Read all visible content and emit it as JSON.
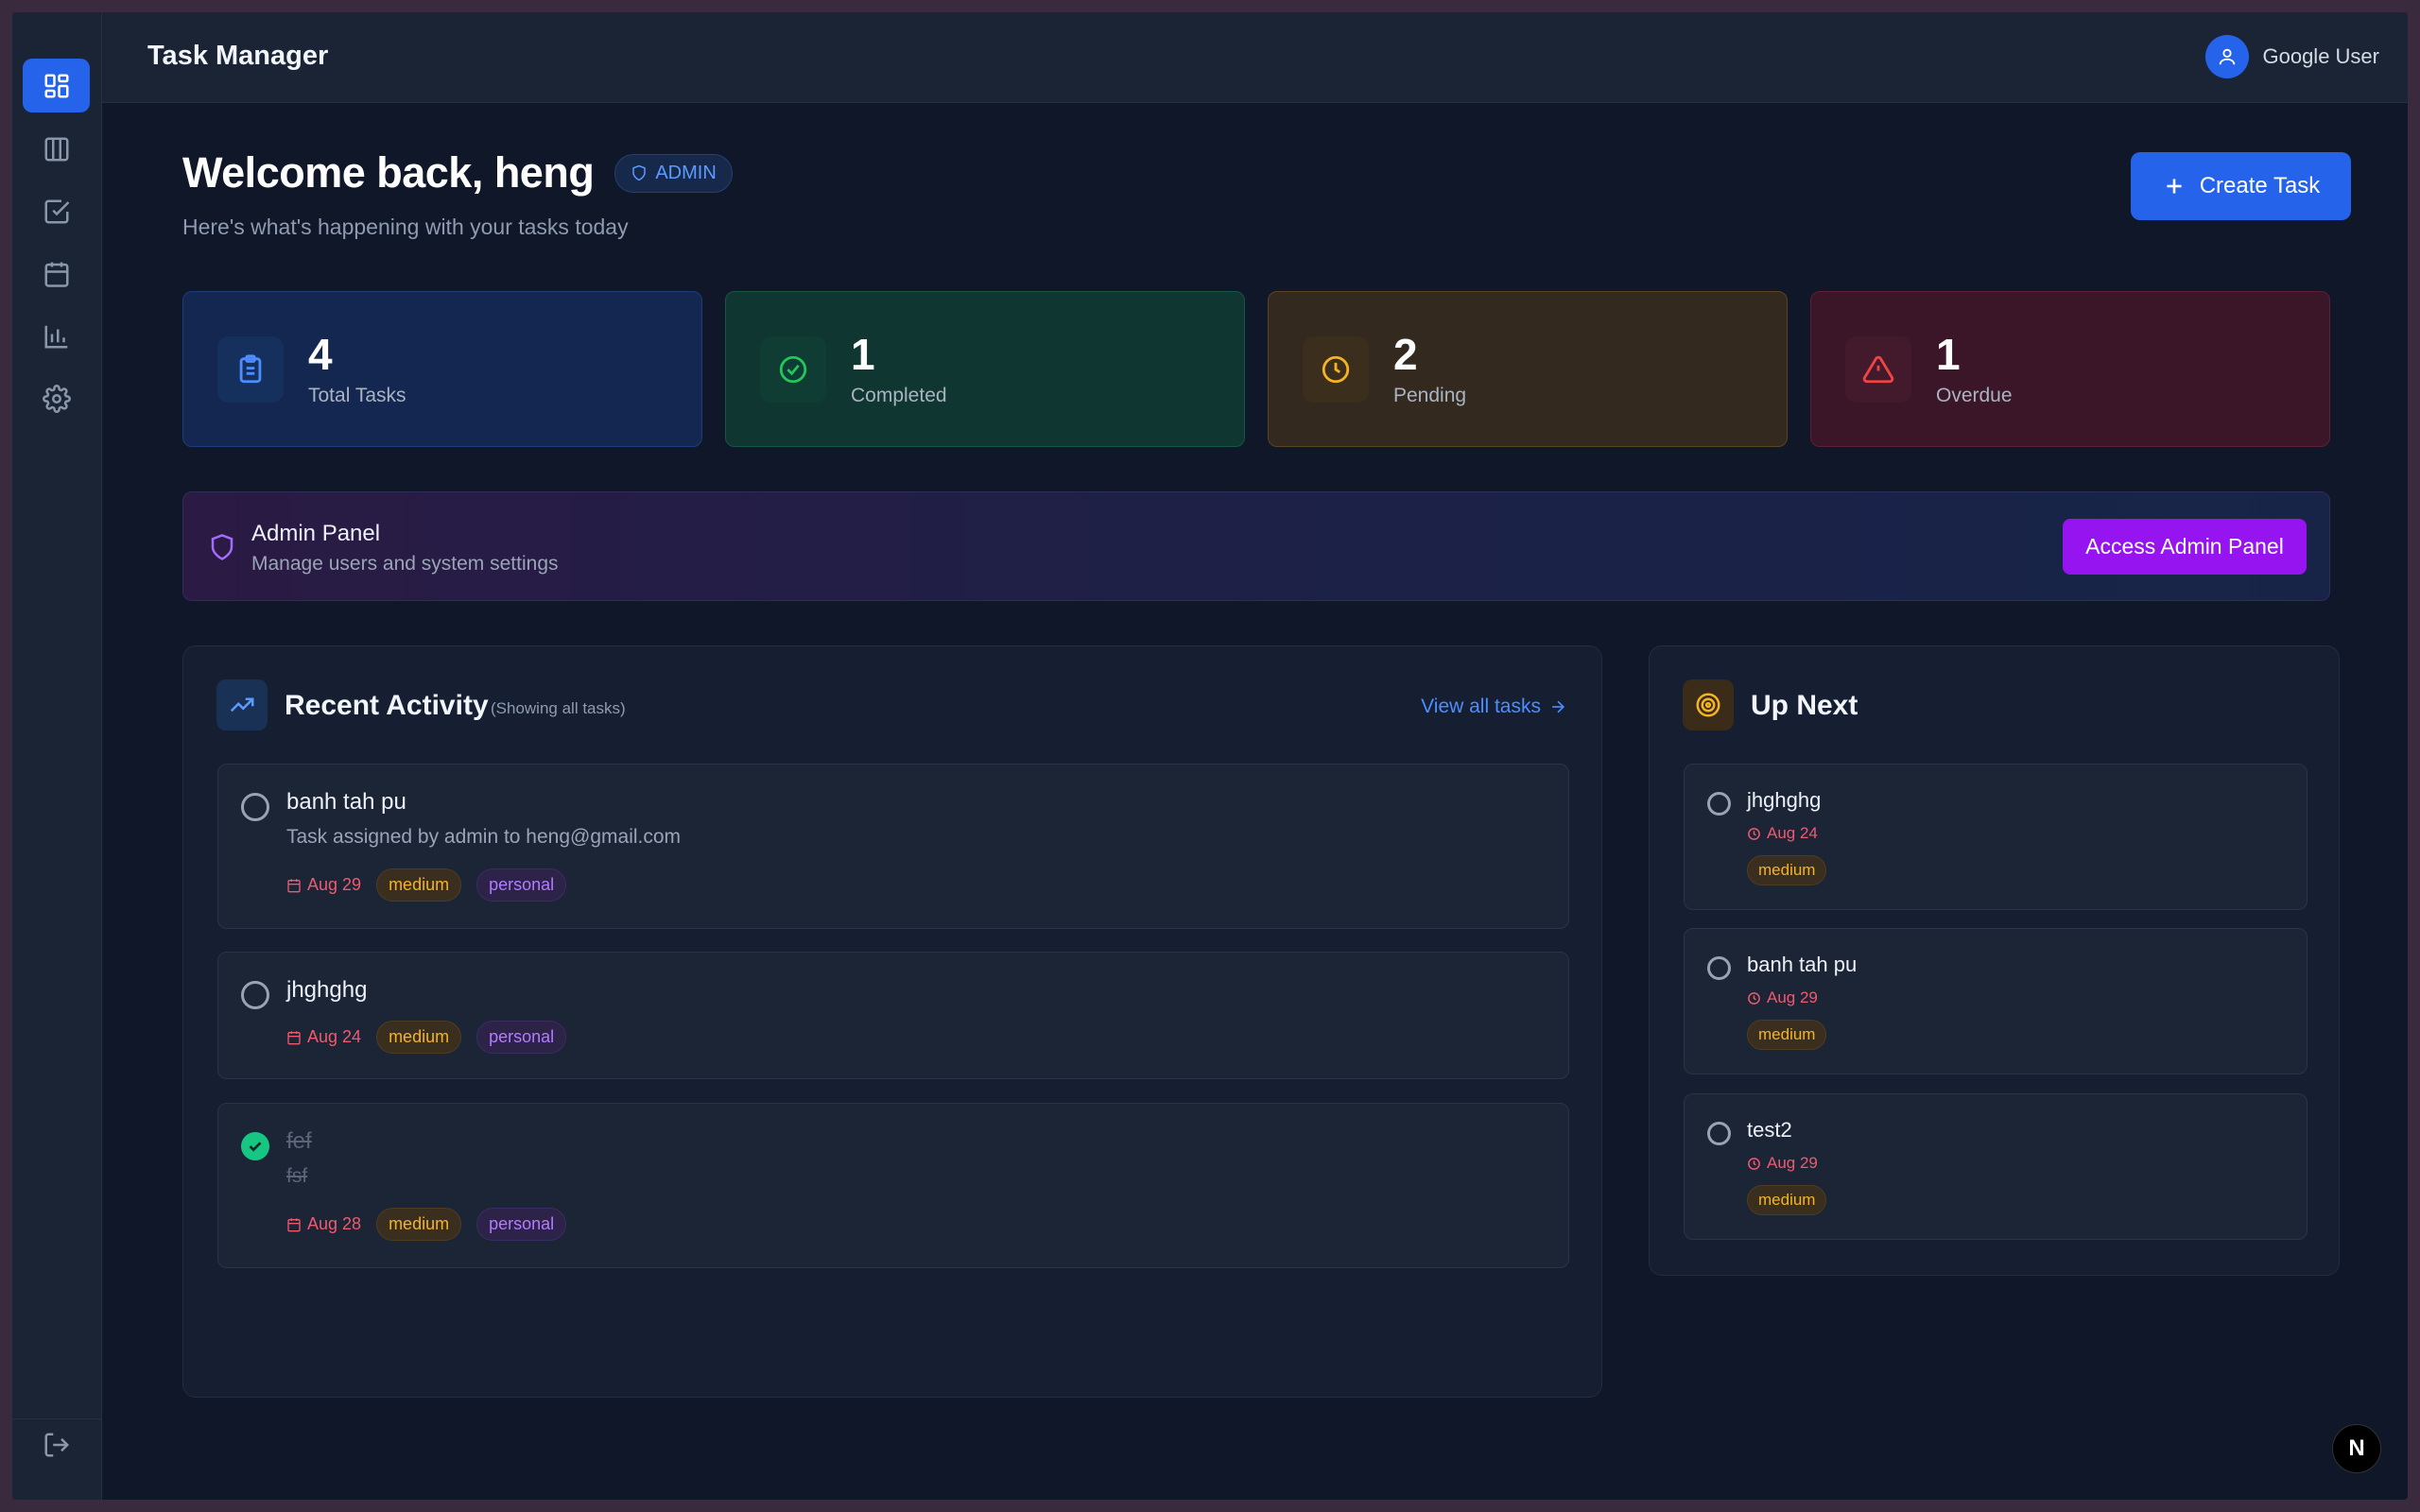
{
  "header": {
    "title": "Task Manager",
    "user_name": "Google User"
  },
  "sidebar": {
    "items": [
      {
        "name": "dashboard",
        "icon": "grid-icon",
        "active": true
      },
      {
        "name": "board",
        "icon": "columns-icon",
        "active": false
      },
      {
        "name": "tasks",
        "icon": "check-square-icon",
        "active": false
      },
      {
        "name": "calendar",
        "icon": "calendar-icon",
        "active": false
      },
      {
        "name": "analytics",
        "icon": "bar-chart-icon",
        "active": false
      },
      {
        "name": "settings",
        "icon": "gear-icon",
        "active": false
      }
    ],
    "logout_icon": "logout-icon"
  },
  "welcome": {
    "heading": "Welcome back, heng",
    "badge": "ADMIN",
    "subtitle": "Here's what's happening with your tasks today",
    "create_label": "Create Task"
  },
  "stats": [
    {
      "value": "4",
      "label": "Total Tasks",
      "color": "#4d8dff"
    },
    {
      "value": "1",
      "label": "Completed",
      "color": "#22c55e"
    },
    {
      "value": "2",
      "label": "Pending",
      "color": "#f5b324"
    },
    {
      "value": "1",
      "label": "Overdue",
      "color": "#ef4444"
    }
  ],
  "admin_panel": {
    "title": "Admin Panel",
    "subtitle": "Manage users and system settings",
    "button": "Access Admin Panel"
  },
  "recent": {
    "title": "Recent Activity",
    "note": "(Showing all tasks)",
    "view_all": "View all tasks",
    "tasks": [
      {
        "title": "banh tah pu",
        "description": "Task assigned by admin to heng@gmail.com",
        "date": "Aug 29",
        "priority": "medium",
        "category": "personal",
        "completed": false
      },
      {
        "title": "jhghghg",
        "description": "",
        "date": "Aug 24",
        "priority": "medium",
        "category": "personal",
        "completed": false
      },
      {
        "title": "fef",
        "description": "fsf",
        "date": "Aug 28",
        "priority": "medium",
        "category": "personal",
        "completed": true
      }
    ]
  },
  "upnext": {
    "title": "Up Next",
    "tasks": [
      {
        "title": "jhghghg",
        "date": "Aug 24",
        "priority": "medium"
      },
      {
        "title": "banh tah pu",
        "date": "Aug 29",
        "priority": "medium"
      },
      {
        "title": "test2",
        "date": "Aug 29",
        "priority": "medium"
      }
    ]
  },
  "dev_badge": "N"
}
